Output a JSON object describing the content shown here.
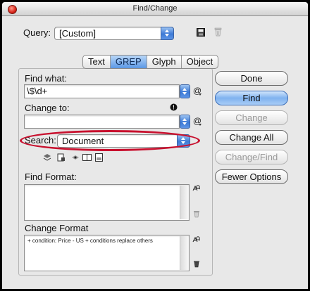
{
  "window": {
    "title": "Find/Change"
  },
  "query": {
    "label": "Query:",
    "value": "[Custom]"
  },
  "tabs": [
    {
      "label": "Text",
      "active": false
    },
    {
      "label": "GREP",
      "active": true
    },
    {
      "label": "Glyph",
      "active": false
    },
    {
      "label": "Object",
      "active": false
    }
  ],
  "find_what": {
    "label": "Find what:",
    "value": "\\$\\d+"
  },
  "change_to": {
    "label": "Change to:",
    "value": ""
  },
  "search": {
    "label": "Search:",
    "value": "Document"
  },
  "find_format": {
    "label": "Find Format:"
  },
  "change_format": {
    "label": "Change Format",
    "value": "+ condition: Price - US  + conditions replace others"
  },
  "buttons": {
    "done": "Done",
    "find": "Find",
    "change": "Change",
    "change_all": "Change All",
    "change_find": "Change/Find",
    "fewer_options": "Fewer Options"
  },
  "icons": {
    "save": "save-query-icon",
    "delete": "delete-query-icon",
    "info": "info-icon",
    "special_chars": "at-special-characters-icon"
  },
  "colors": {
    "highlight_oval": "#c8102e",
    "accent": "#3d7ad6"
  }
}
